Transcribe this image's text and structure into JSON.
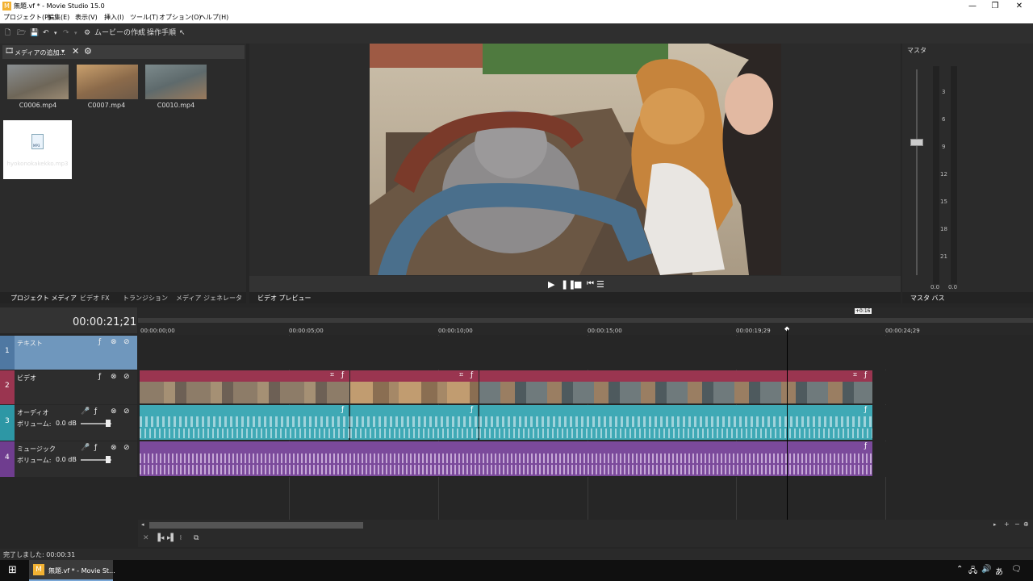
{
  "window": {
    "title": "無題.vf * - Movie Studio 15.0",
    "minimize": "—",
    "maximize": "❐",
    "close": "✕"
  },
  "menu": [
    "プロジェクト(P)",
    "編集(E)",
    "表示(V)",
    "挿入(I)",
    "ツール(T)",
    "オプション(O)",
    "ヘルプ(H)"
  ],
  "toolbar": {
    "make_movie": "ムービーの作成",
    "tutorial": "操作手順"
  },
  "media_panel": {
    "dropdown_label": "メディアの追加...",
    "files": [
      {
        "name": "C0006.mp4"
      },
      {
        "name": "C0007.mp4"
      },
      {
        "name": "C0010.mp4"
      },
      {
        "name": "hyokonokakekko.mp3",
        "icon_label": "MP3"
      }
    ],
    "tabs": [
      "プロジェクト メディア",
      "ビデオ FX",
      "トランジション",
      "メディア ジェネレータ"
    ]
  },
  "preview": {
    "tab": "ビデオ プレビュー"
  },
  "master": {
    "title": "マスタ",
    "scale": [
      "3",
      "6",
      "9",
      "12",
      "15",
      "18",
      "21"
    ],
    "left_level": "0.0",
    "right_level": "0.0",
    "tab": "マスタ バス"
  },
  "timeline": {
    "timecode": "00:00:21;21",
    "region_marker": "+0:16",
    "ruler": [
      "00:00:00;00",
      "00:00:05;00",
      "00:00:10;00",
      "00:00:15;00",
      "00:00:19;29",
      "00:00:24;29"
    ],
    "tracks": [
      {
        "index": "1",
        "name": "テキスト",
        "color": "#6f97bd"
      },
      {
        "index": "2",
        "name": "ビデオ",
        "color": "#9a3550"
      },
      {
        "index": "3",
        "name": "オーディオ",
        "volume_label": "ボリューム:",
        "volume_value": "0.0 dB",
        "color": "#2d97a5"
      },
      {
        "index": "4",
        "name": "ミュージック",
        "volume_label": "ボリューム:",
        "volume_value": "0.0 dB",
        "color": "#6f3d8f"
      }
    ]
  },
  "status": {
    "text": "完了しました: 00:00:31"
  },
  "taskbar": {
    "app_label": "無題.vf * - Movie St...",
    "ime": "あ"
  }
}
